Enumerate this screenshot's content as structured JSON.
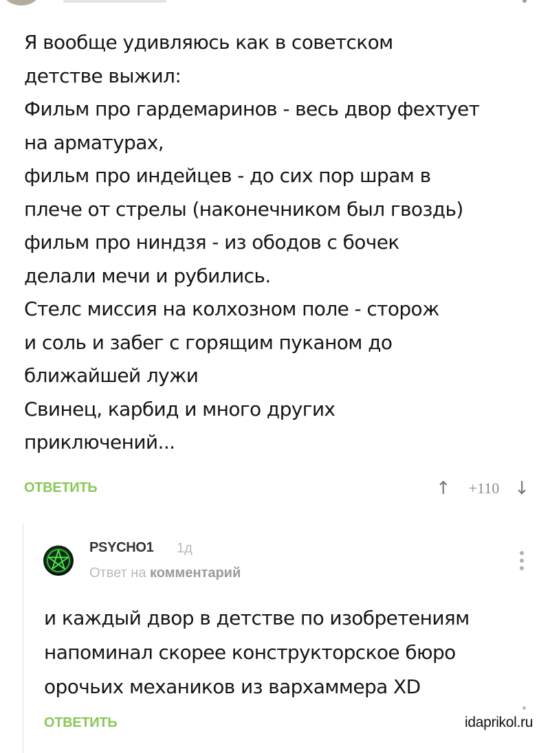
{
  "main_comment": {
    "lines": [
      "Я вообще удивляюсь как в советском",
      "детстве выжил:",
      "Фильм про гардемаринов - весь двор фехтует",
      "на арматурах,",
      "фильм про индейцев - до сих пор шрам в",
      "плече от стрелы (наконечником был гвоздь)",
      "фильм про ниндзя - из ободов с бочек",
      "делали мечи и рубились.",
      "Стелс миссия на колхозном поле - сторож",
      "и соль и забег с горящим пуканом до",
      "ближайшей лужи",
      "Свинец, карбид и много других",
      "приключений..."
    ],
    "reply_label": "ОТВЕТИТЬ",
    "rating": "+110",
    "upvote_icon": "↑",
    "downvote_icon": "↓"
  },
  "reply_comment": {
    "author": "PSYCHO1",
    "time": "1д",
    "reply_to_prefix": "Ответ на",
    "reply_to_link": "комментарий",
    "lines": [
      "и каждый двор в детстве по изобретениям",
      "напоминал скорее конструкторское бюро",
      "орочьих механиков из вархаммера XD"
    ],
    "reply_label": "ОТВЕТИТЬ",
    "avatar_icon": "pentagram-icon"
  },
  "watermark": "idaprikol.ru",
  "colors": {
    "accent_green": "#8ac858",
    "text": "#151515",
    "muted": "#b9b9b9",
    "avatar_glow": "#39d63a"
  }
}
